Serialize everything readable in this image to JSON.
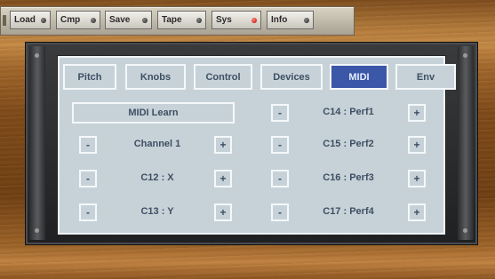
{
  "toolbar": {
    "buttons": [
      {
        "label": "Load",
        "led": "dark"
      },
      {
        "label": "Cmp",
        "led": "dark"
      },
      {
        "label": "Save",
        "led": "dark"
      },
      {
        "label": "Tape",
        "led": "dark"
      },
      {
        "label": "Sys",
        "led": "red"
      },
      {
        "label": "Info",
        "led": "dark"
      }
    ]
  },
  "tabs": [
    "Pitch",
    "Knobs",
    "Control",
    "Devices",
    "MIDI",
    "Env"
  ],
  "active_tab": "MIDI",
  "midi": {
    "learn": "MIDI Learn",
    "left_rows": [
      "Channel 1",
      "C12 : X",
      "C13 : Y"
    ],
    "right_rows": [
      "C14 : Perf1",
      "C15 : Perf2",
      "C16 : Perf3",
      "C17 : Perf4"
    ],
    "minus": "-",
    "plus": "+"
  },
  "colors": {
    "active_tab": "#3a57a8",
    "lcd": "#c7d2d8",
    "text": "#3e4f63",
    "led_on": "#c00000"
  }
}
